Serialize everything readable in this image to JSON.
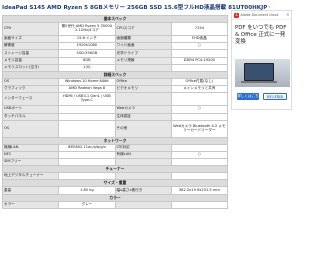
{
  "title": "IdeaPad S145 AMD Ryzen 5 8GBメモリー 256GB SSD 15.6型フルHD液晶搭載 81UT00HKJP のスペック・仕様・特長",
  "sections": {
    "basic": "基本スペック",
    "detail": "詳細スペック",
    "network": "ネットワーク",
    "tuner": "チューナー",
    "size": "サイズ・重量",
    "color": "カラー"
  },
  "basic_rows": [
    [
      "CPU",
      "第2世代 AMD Ryzen 5 3500U 2.1GHz/4コア",
      "CPUスコア",
      "7154"
    ],
    [
      "画面サイズ",
      "15.6 インチ",
      "画面種類",
      "FHD液晶"
    ],
    [
      "解像度",
      "1920x1080",
      "ワイド画面",
      "○"
    ],
    [
      "ストレージ容量",
      "SSD:256GB",
      "光学ドライブ",
      ""
    ],
    [
      "メモリ容量",
      "8GB",
      "メモリ規格",
      "DDR4 PC4-19200"
    ],
    [
      "メモリスロット(空き)",
      "1(0)",
      "",
      ""
    ]
  ],
  "detail_rows": [
    [
      "OS",
      "Windows 10 Home 64bit",
      "Office",
      "Office付属(なし)"
    ],
    [
      "グラフィック",
      "AMD Radeon Vega 8",
      "ビデオメモリ",
      "メインメモリと共有"
    ],
    [
      "インターフェース",
      "HDMI / USB3.1 Gen1 / USB Type-C",
      "",
      ""
    ],
    [
      "USBポート",
      "",
      "Webカメラ",
      "○"
    ],
    [
      "タッチパネル",
      "",
      "生体認証",
      ""
    ],
    [
      "OS",
      "",
      "その他",
      "Webカメラ Bluetooth 4.2 メモリーカードリーダー"
    ]
  ],
  "network_rows": [
    [
      "無線LAN",
      "IEEE802.11ac/a/b/g/n",
      "LTE対応",
      ""
    ],
    [
      "NFC",
      "",
      "有線LAN",
      "○"
    ],
    [
      "SIMフリー",
      "",
      "",
      ""
    ]
  ],
  "tuner_rows": [
    [
      "地上デジタルチューナー",
      "",
      "",
      ""
    ]
  ],
  "size_rows": [
    [
      "重量",
      "1.85 kg",
      "幅x高さx奥行き",
      "362.2x19.9x251.5 mm"
    ]
  ],
  "color_rows": [
    [
      "カラー",
      "グレー",
      "",
      ""
    ]
  ],
  "ad": {
    "brand": "Adobe Document Cloud",
    "text": "PDF をいつでも PDF & Office 正式に一発変換",
    "button1": "詳しくはこちら",
    "button2": "無料体験版"
  }
}
